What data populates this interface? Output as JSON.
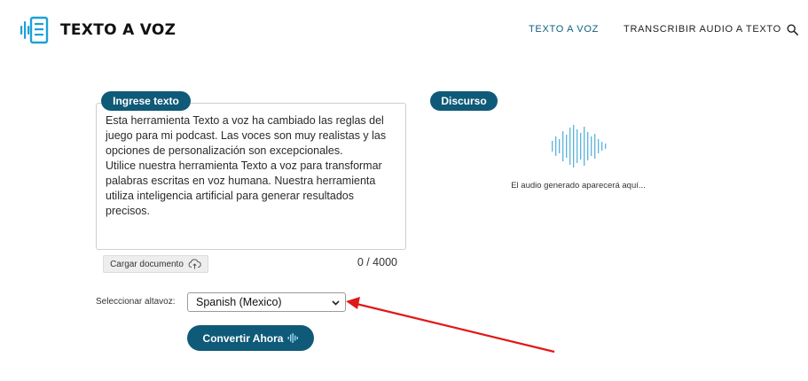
{
  "brand": {
    "name": "TEXTO A VOZ",
    "logo_icon": "document-audio-icon",
    "accent": "#1ea0d8"
  },
  "nav": {
    "items": [
      {
        "label": "TEXTO A VOZ",
        "active": true
      },
      {
        "label": "TRANSCRIBIR AUDIO A TEXTO",
        "active": false
      }
    ],
    "search_icon": "search-icon"
  },
  "input": {
    "label": "Ingrese texto",
    "text": "Esta herramienta Texto a voz ha cambiado las reglas del juego para mi podcast. Las voces son muy realistas y las opciones de personalización son excepcionales.\nUtilice nuestra herramienta Texto a voz para transformar palabras escritas en voz humana. Nuestra herramienta utiliza inteligencia artificial para generar resultados precisos.",
    "upload_label": "Cargar documento",
    "upload_icon": "cloud-upload-icon",
    "counter": "0 / 4000"
  },
  "speech": {
    "label": "Discurso",
    "placeholder": "El audio generado aparecerá aquí...",
    "wave_icon": "soundwave-icon"
  },
  "speaker": {
    "label": "Seleccionar altavoz:",
    "selected": "Spanish (Mexico)"
  },
  "convert": {
    "label": "Convertir Ahora",
    "icon": "soundwave-icon"
  },
  "colors": {
    "primary": "#0f5a78",
    "arrow": "#e01818",
    "wave": "#5ab4dd"
  }
}
